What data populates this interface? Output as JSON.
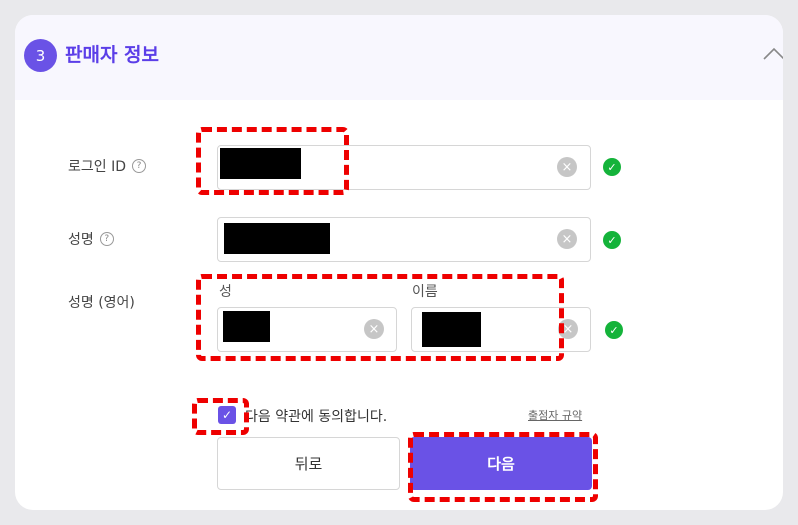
{
  "header": {
    "step": "3",
    "title": "판매자 정보"
  },
  "fields": {
    "login_id": {
      "label": "로그인 ID",
      "help": "?"
    },
    "name": {
      "label": "성명",
      "help": "?"
    },
    "english_name": {
      "label": "성명 (영어)",
      "last_label": "성",
      "first_label": "이름"
    }
  },
  "icons": {
    "clear": "×",
    "ok": "✓",
    "check": "✓"
  },
  "agreement": {
    "text": "다음 약관에 동의합니다.",
    "link": "출점자 규약",
    "checked": true
  },
  "buttons": {
    "back": "뒤로",
    "next": "다음"
  },
  "colors": {
    "accent": "#6a52e6",
    "success": "#14b33a",
    "annotation": "#ee0000"
  }
}
